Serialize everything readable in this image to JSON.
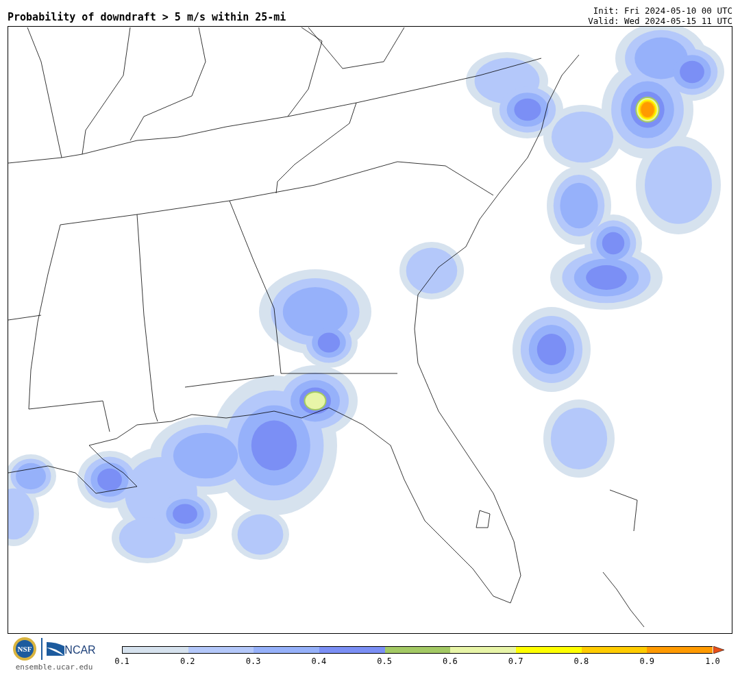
{
  "header": {
    "title": "Probability of downdraft > 5 m/s within 25-mi",
    "init": "Init: Fri 2024-05-10 00 UTC",
    "valid": "Valid: Wed 2024-05-15 11 UTC"
  },
  "footer": {
    "nsf_logo": "NSF",
    "ncar_logo": "NCAR",
    "url": "ensemble.ucar.edu"
  },
  "colorbar": {
    "bins": [
      {
        "color": "#d6e2ee"
      },
      {
        "color": "#b4c8fa"
      },
      {
        "color": "#96b1fa"
      },
      {
        "color": "#7b8ff5"
      },
      {
        "color": "#a3c964"
      },
      {
        "color": "#e8f5a8"
      },
      {
        "color": "#ffff00"
      },
      {
        "color": "#ffcc00"
      },
      {
        "color": "#ff9a00"
      }
    ],
    "extension": {
      "color": "#e8501a"
    },
    "ticks": [
      "0.1",
      "0.2",
      "0.3",
      "0.4",
      "0.5",
      "0.6",
      "0.7",
      "0.8",
      "0.9",
      "1.0"
    ]
  }
}
